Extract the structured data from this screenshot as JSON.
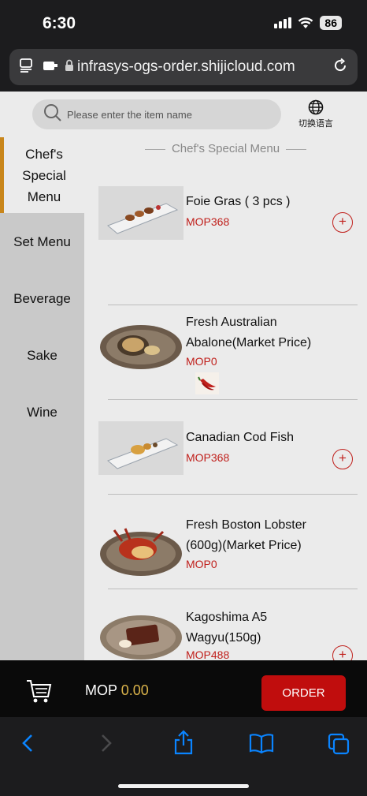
{
  "status": {
    "time": "6:30",
    "battery": "86"
  },
  "browser": {
    "url": "infrasys-ogs-order.shijicloud.com"
  },
  "search": {
    "placeholder": "Please enter the item name"
  },
  "language": {
    "label": "切换语言"
  },
  "sidebar": {
    "items": [
      {
        "label": "Chef's Special Menu",
        "active": true
      },
      {
        "label": "Set Menu"
      },
      {
        "label": "Beverage"
      },
      {
        "label": "Sake"
      },
      {
        "label": "Wine"
      }
    ]
  },
  "menu": {
    "section_title": "Chef's Special Menu",
    "items": [
      {
        "name": "Foie Gras ( 3 pcs )",
        "price": "MOP368",
        "add": "+"
      },
      {
        "name": "Fresh Australian Abalone(Market Price)",
        "price": "MOP0"
      },
      {
        "name": "Canadian Cod Fish",
        "price": "MOP368",
        "add": "+"
      },
      {
        "name": "Fresh Boston Lobster (600g)(Market Price)",
        "price": "MOP0"
      },
      {
        "name": "Kagoshima A5 Wagyu(150g)",
        "price": "MOP488",
        "add": "+"
      }
    ]
  },
  "cart": {
    "currency": "MOP",
    "amount": "0.00",
    "order_label": "ORDER"
  },
  "colors": {
    "accent": "#c9861b",
    "price": "#c0201c",
    "order": "#c00d0d",
    "ios_blue": "#0a84ff"
  }
}
